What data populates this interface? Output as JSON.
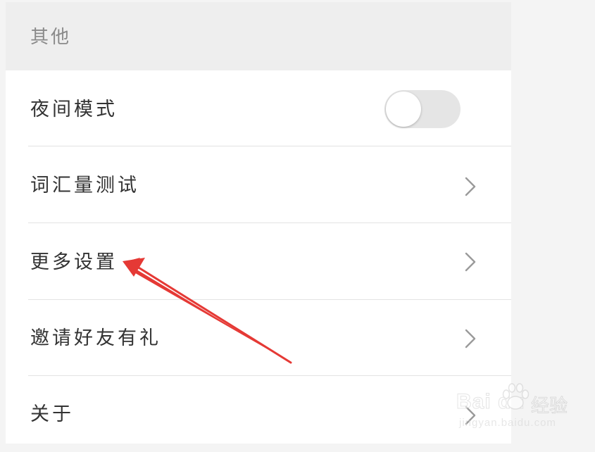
{
  "section": {
    "title": "其他"
  },
  "rows": [
    {
      "label": "夜间模式",
      "control": "toggle",
      "toggle_on": false
    },
    {
      "label": "词汇量测试",
      "control": "chevron"
    },
    {
      "label": "更多设置",
      "control": "chevron"
    },
    {
      "label": "邀请好友有礼",
      "control": "chevron"
    },
    {
      "label": "关于",
      "control": "chevron"
    }
  ],
  "annotation": {
    "arrow_color": "#e53935",
    "points_to": "更多设置"
  },
  "watermark": {
    "brand": "Bai du",
    "text": "经验",
    "url": "jingyan.baidu.com"
  },
  "colors": {
    "background": "#f4f4f4",
    "panel": "#ffffff",
    "header": "#eeeeee",
    "label": "#333333",
    "muted": "#8a8a8a",
    "toggle_off": "#e5e5e5",
    "chevron": "#9a9a9a"
  }
}
